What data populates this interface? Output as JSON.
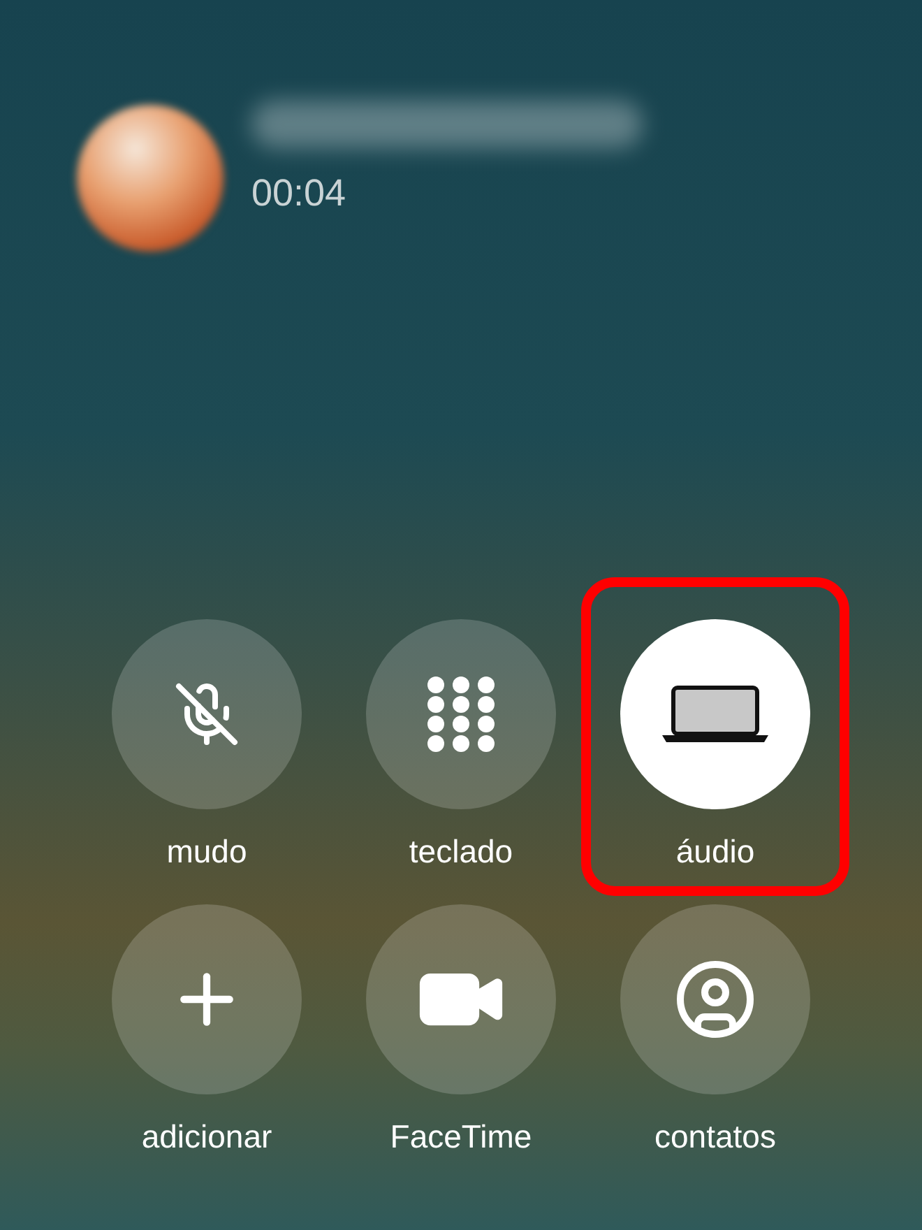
{
  "call": {
    "duration": "00:04"
  },
  "controls": [
    {
      "kind": "mute",
      "label": "mudo",
      "selected": false,
      "highlighted": false
    },
    {
      "kind": "keypad",
      "label": "teclado",
      "selected": false,
      "highlighted": false
    },
    {
      "kind": "audio",
      "label": "áudio",
      "selected": true,
      "highlighted": true
    },
    {
      "kind": "add",
      "label": "adicionar",
      "selected": false,
      "highlighted": false
    },
    {
      "kind": "facetime",
      "label": "FaceTime",
      "selected": false,
      "highlighted": false
    },
    {
      "kind": "contacts",
      "label": "contatos",
      "selected": false,
      "highlighted": false
    }
  ]
}
